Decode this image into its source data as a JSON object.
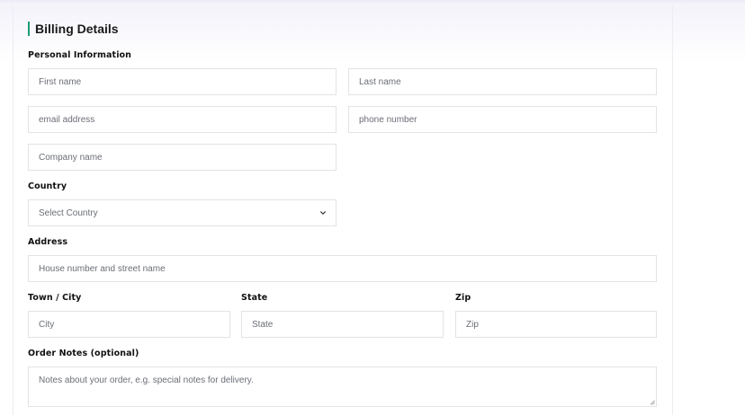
{
  "billing": {
    "title": "Billing Details",
    "accent_color": "#1a9b74"
  },
  "sections": {
    "personal": "Personal Information",
    "country": "Country",
    "address": "Address",
    "town": "Town / City",
    "state": "State",
    "zip": "Zip",
    "notes": "Order Notes (optional)"
  },
  "fields": {
    "first_name": {
      "placeholder": "First name",
      "value": ""
    },
    "last_name": {
      "placeholder": "Last name",
      "value": ""
    },
    "email": {
      "placeholder": "email address",
      "value": ""
    },
    "phone": {
      "placeholder": "phone number",
      "value": ""
    },
    "company": {
      "placeholder": "Company name",
      "value": ""
    },
    "country": {
      "selected": "Select Country"
    },
    "address": {
      "placeholder": "House number and street name",
      "value": ""
    },
    "city": {
      "placeholder": "City",
      "value": ""
    },
    "state": {
      "placeholder": "State",
      "value": ""
    },
    "zip": {
      "placeholder": "Zip",
      "value": ""
    },
    "notes": {
      "placeholder": "Notes about your order, e.g. special notes for delivery.",
      "value": ""
    }
  },
  "icons": {
    "select_chevron": "chevron-down-icon",
    "textarea_resize": "resize-handle-icon"
  }
}
